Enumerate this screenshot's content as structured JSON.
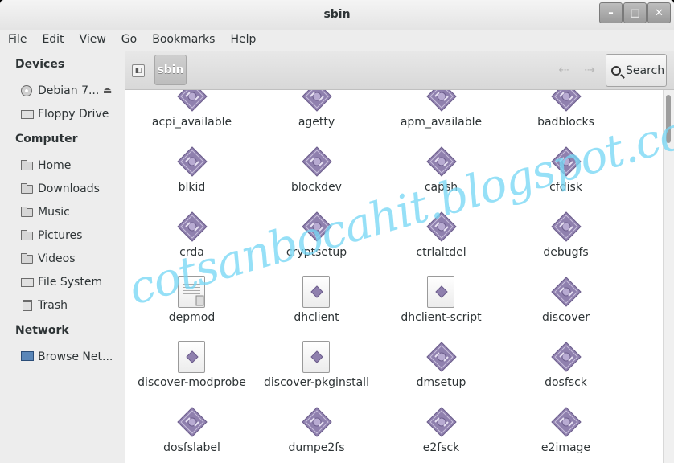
{
  "window": {
    "title": "sbin"
  },
  "menu": [
    "File",
    "Edit",
    "View",
    "Go",
    "Bookmarks",
    "Help"
  ],
  "sidebar": {
    "devices_header": "Devices",
    "devices": [
      {
        "label": "Debian 7...",
        "icon": "disc-icon"
      },
      {
        "label": "Floppy Drive",
        "icon": "drive-icon"
      }
    ],
    "computer_header": "Computer",
    "computer": [
      {
        "label": "Home",
        "icon": "folder-icon"
      },
      {
        "label": "Downloads",
        "icon": "folder-icon"
      },
      {
        "label": "Music",
        "icon": "folder-icon"
      },
      {
        "label": "Pictures",
        "icon": "folder-icon"
      },
      {
        "label": "Videos",
        "icon": "folder-icon"
      },
      {
        "label": "File System",
        "icon": "drive-icon"
      },
      {
        "label": "Trash",
        "icon": "trash-icon"
      }
    ],
    "network_header": "Network",
    "network": [
      {
        "label": "Browse Net...",
        "icon": "network-icon"
      }
    ]
  },
  "toolbar": {
    "breadcrumb": "sbin",
    "search_label": "Search"
  },
  "files": [
    {
      "name": "acpi_available",
      "type": "executable"
    },
    {
      "name": "agetty",
      "type": "executable"
    },
    {
      "name": "apm_available",
      "type": "executable"
    },
    {
      "name": "badblocks",
      "type": "executable"
    },
    {
      "name": "blkid",
      "type": "executable"
    },
    {
      "name": "blockdev",
      "type": "executable"
    },
    {
      "name": "capsh",
      "type": "executable"
    },
    {
      "name": "cfdisk",
      "type": "executable"
    },
    {
      "name": "crda",
      "type": "executable"
    },
    {
      "name": "cryptsetup",
      "type": "executable"
    },
    {
      "name": "ctrlaltdel",
      "type": "executable"
    },
    {
      "name": "debugfs",
      "type": "executable"
    },
    {
      "name": "depmod",
      "type": "text"
    },
    {
      "name": "dhclient",
      "type": "script"
    },
    {
      "name": "dhclient-script",
      "type": "script"
    },
    {
      "name": "discover",
      "type": "executable"
    },
    {
      "name": "discover-modprobe",
      "type": "script"
    },
    {
      "name": "discover-pkginstall",
      "type": "script"
    },
    {
      "name": "dmsetup",
      "type": "executable"
    },
    {
      "name": "dosfsck",
      "type": "executable"
    },
    {
      "name": "dosfslabel",
      "type": "executable"
    },
    {
      "name": "dumpe2fs",
      "type": "executable"
    },
    {
      "name": "e2fsck",
      "type": "executable"
    },
    {
      "name": "e2image",
      "type": "executable"
    }
  ],
  "watermark": "cotsanbocahit.blogspot.com",
  "colors": {
    "exec_icon": "#8f80ae",
    "watermark": "#78d7f5"
  }
}
